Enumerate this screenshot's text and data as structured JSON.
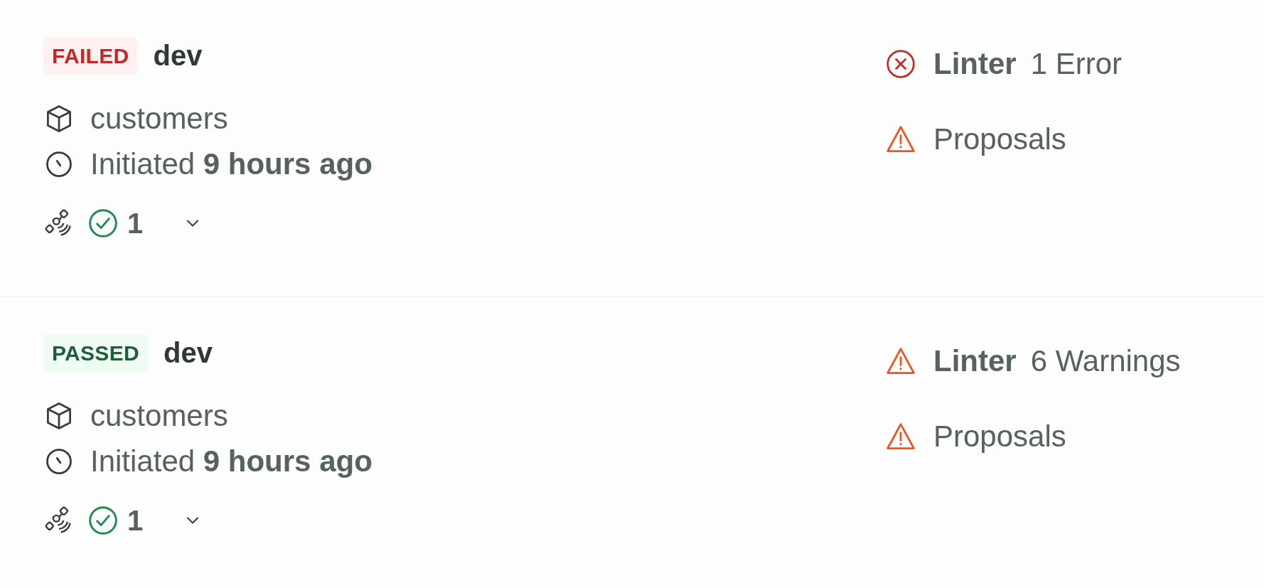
{
  "runs": [
    {
      "status": {
        "kind": "failed",
        "label": "FAILED"
      },
      "branch": "dev",
      "project": "customers",
      "initiated": "Initiated **9 hours ago**",
      "passed_count": "1",
      "checks": [
        {
          "kind": "error",
          "name": "Linter",
          "detail": "1 Error"
        },
        {
          "kind": "warning",
          "name": "Proposals"
        }
      ]
    },
    {
      "status": {
        "kind": "passed",
        "label": "PASSED"
      },
      "branch": "dev",
      "project": "customers",
      "initiated": "Initiated **9 hours ago**",
      "passed_count": "1",
      "checks": [
        {
          "kind": "warning",
          "name": "Linter",
          "detail": "6 Warnings"
        },
        {
          "kind": "warning",
          "name": "Proposals"
        }
      ]
    }
  ]
}
